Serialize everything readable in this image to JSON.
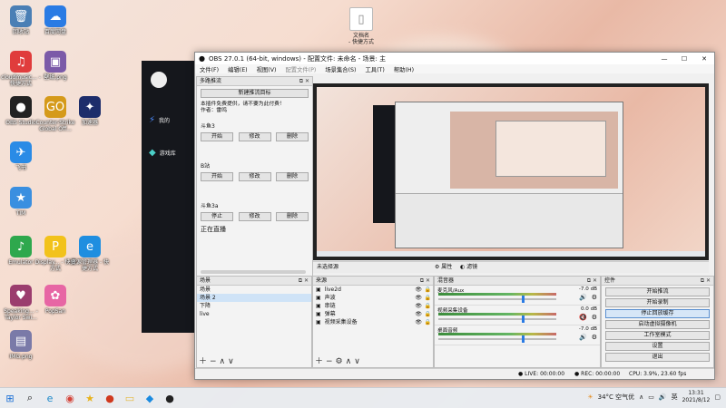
{
  "desktop_icons": [
    {
      "label": "回收站",
      "color": "#4a7fb5",
      "glyph": "🗑"
    },
    {
      "label": "百度网盘",
      "color": "#2a7be4",
      "glyph": "☁"
    },
    {
      "label": "cloudmusic... - 快捷方式",
      "color": "#e03c3c",
      "glyph": "♫"
    },
    {
      "label": "壁纸.png",
      "color": "#7b5aa8",
      "glyph": "▣"
    },
    {
      "label": "OBS Studio",
      "color": "#222",
      "glyph": "●"
    },
    {
      "label": "Counter-Strike Global Off...",
      "color": "#d59a1a",
      "glyph": "GO"
    },
    {
      "label": "加速器",
      "color": "#1d2d6b",
      "glyph": "✦"
    },
    {
      "label": "飞书",
      "color": "#2a8be6",
      "glyph": "✈"
    },
    {
      "label": "TIM",
      "color": "#3a8fe0",
      "glyph": "★"
    },
    {
      "label": "Emulator",
      "color": "#2ea84d",
      "glyph": "♪"
    },
    {
      "label": "Display... - 快捷方式",
      "color": "#f2c21b",
      "glyph": "P"
    },
    {
      "label": "资源管理器 - 快捷方式",
      "color": "#1f8ee0",
      "glyph": "e"
    },
    {
      "label": "Speaking... - Taylor Swi...",
      "color": "#9b3d6e",
      "glyph": "♥"
    },
    {
      "label": "PopSan",
      "color": "#e766a4",
      "glyph": "✿"
    },
    {
      "label": "IMG.png",
      "color": "#7a7aa8",
      "glyph": "▤"
    }
  ],
  "desktop_file": {
    "label": "文档名\n- 快捷方式"
  },
  "bgapp": {
    "items": [
      "我的",
      "游戏库"
    ]
  },
  "obs": {
    "title": "OBS 27.0.1 (64-bit, windows) - 配置文件: 未命名 - 场景: 主",
    "menu": [
      "文件(F)",
      "编辑(E)",
      "视图(V)",
      "配置文件(P)",
      "场景集合(S)",
      "工具(T)",
      "帮助(H)"
    ],
    "multi_stream": {
      "title": "多路推流",
      "new_target": "新建推流目标",
      "note": "本插件免费提供，请不要为此付费！\n作者：雷鸣",
      "targets": [
        {
          "name": "斗鱼3",
          "buttons": [
            "开始",
            "修改",
            "删除"
          ]
        },
        {
          "name": "B站",
          "buttons": [
            "开始",
            "修改",
            "删除"
          ]
        },
        {
          "name": "斗鱼3a",
          "buttons": [
            "停止",
            "修改",
            "删除"
          ],
          "status": "正在直播"
        }
      ]
    },
    "scene_tabs": [
      "未选择源"
    ],
    "tab_buttons": [
      "属性",
      "滤镜"
    ],
    "docks": {
      "scenes": "场景",
      "sources": "来源",
      "mixer": "混音器",
      "controls": "控件"
    },
    "scenes": [
      "场景",
      "场景 2",
      "下降",
      "live"
    ],
    "sources": [
      "live2d",
      "声波",
      "串链",
      "弹幕",
      "视频采集设备"
    ],
    "mixer": [
      {
        "name": "麦克风/Aux",
        "db": "-7.0 dB"
      },
      {
        "name": "视频采集设备",
        "db": "0.0 dB"
      },
      {
        "name": "桌面音频",
        "db": "-7.0 dB"
      }
    ],
    "controls": [
      "开始推流",
      "开始录制",
      "停止回放缓存",
      "启动虚拟摄像机",
      "工作室模式",
      "设置",
      "退出"
    ],
    "status": {
      "live": "LIVE: 00:00:00",
      "rec": "REC: 00:00:00",
      "cpu": "CPU: 3.9%, 23.60 fps"
    }
  },
  "taskbar": {
    "weather": "34°C 空气优",
    "time": "13:31",
    "date": "2021/8/12"
  }
}
